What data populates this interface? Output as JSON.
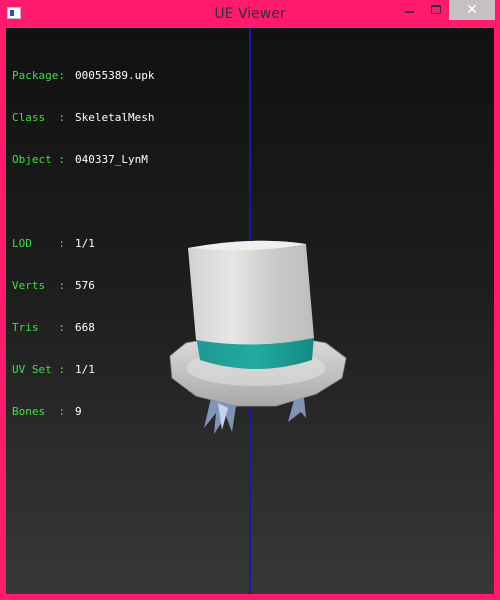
{
  "window": {
    "title": "UE Viewer",
    "accent_color": "#ff1a6e",
    "controls": {
      "minimize_icon": "minimize-icon",
      "maximize_icon": "maximize-icon",
      "close_icon": "close-icon",
      "close_glyph": "✕"
    }
  },
  "viewport": {
    "info_lines": [
      {
        "label": "Package",
        "value": "00055389.upk"
      },
      {
        "label": "Class  ",
        "value": "SkeletalMesh"
      },
      {
        "label": "Object ",
        "value": "040337_LynM"
      }
    ],
    "stats_lines": [
      {
        "label": "LOD    ",
        "value": "1/1"
      },
      {
        "label": "Verts  ",
        "value": "576"
      },
      {
        "label": "Tris   ",
        "value": "668"
      },
      {
        "label": "UV Set ",
        "value": "1/1"
      },
      {
        "label": "Bones  ",
        "value": "9"
      }
    ],
    "label_color": "#3fe043",
    "value_color": "#ffffff",
    "axis_color": "#1a18a8",
    "model": "top-hat"
  }
}
